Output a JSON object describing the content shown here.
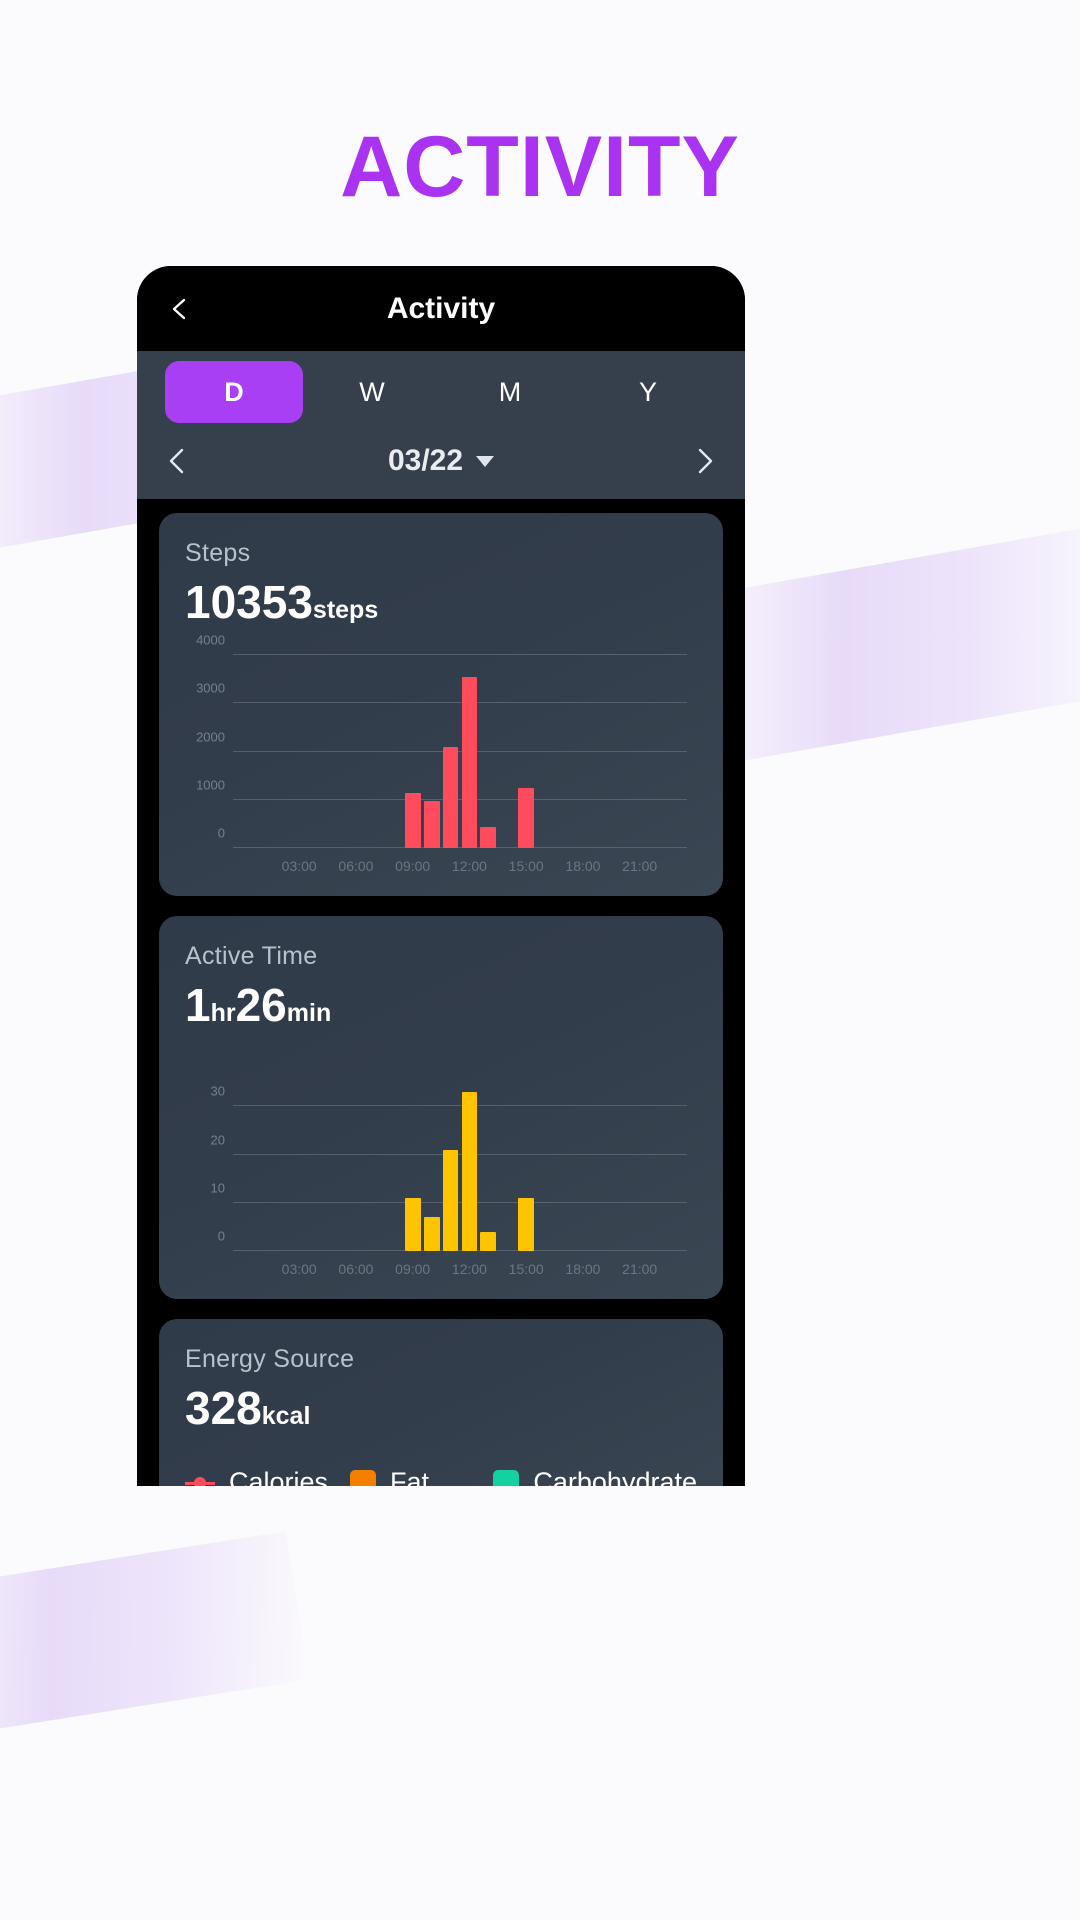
{
  "page": {
    "title": "ACTIVITY",
    "accent_purple": "#a933f0",
    "background": "#fbfafd"
  },
  "phone": {
    "navbar": {
      "title": "Activity",
      "back_icon": "chevron-left-icon"
    },
    "segments": [
      {
        "label": "D",
        "active": true
      },
      {
        "label": "W",
        "active": false
      },
      {
        "label": "M",
        "active": false
      },
      {
        "label": "Y",
        "active": false
      }
    ],
    "date_nav": {
      "prev_icon": "chevron-left-icon",
      "next_icon": "chevron-right-icon",
      "date": "03/22",
      "dropdown_icon": "caret-down-icon"
    },
    "cards": [
      {
        "label": "Steps",
        "value": "10353",
        "unit": "steps"
      },
      {
        "label": "Active Time",
        "value_parts": [
          {
            "num": "1",
            "unit": "hr"
          },
          {
            "num": "26",
            "unit": "min"
          }
        ]
      },
      {
        "label": "Energy Source",
        "value": "328",
        "unit": "kcal",
        "legend": [
          {
            "name": "Calories",
            "color": "#ff4b5c",
            "marker": "line-dot"
          },
          {
            "name": "Fat",
            "color": "#f58000",
            "marker": "square"
          },
          {
            "name": "Carbohydrate",
            "color": "#13d1a0",
            "marker": "square"
          }
        ]
      }
    ]
  },
  "chart_data": [
    {
      "id": "steps",
      "type": "bar",
      "title": "Steps",
      "color": "#ff4b5c",
      "xlabel": "",
      "ylabel": "steps",
      "ylim": [
        0,
        4000
      ],
      "yticks": [
        0,
        1000,
        2000,
        3000,
        4000
      ],
      "ytick_labels": [
        "0",
        "1000",
        "2000",
        "3000",
        "4000"
      ],
      "xticks": [
        "03:00",
        "06:00",
        "09:00",
        "12:00",
        "15:00",
        "18:00",
        "21:00"
      ],
      "categories": [
        "09:00",
        "10:00",
        "11:00",
        "12:00",
        "13:00",
        "15:00"
      ],
      "values": [
        1150,
        980,
        2100,
        3550,
        430,
        1250
      ],
      "grid": true,
      "total": 10353
    },
    {
      "id": "active_time",
      "type": "bar",
      "title": "Active Time",
      "color": "#ffc400",
      "xlabel": "",
      "ylabel": "min",
      "ylim": [
        0,
        40
      ],
      "yticks": [
        0,
        10,
        20,
        30
      ],
      "ytick_labels": [
        "0",
        "10",
        "20",
        "30"
      ],
      "xticks": [
        "03:00",
        "06:00",
        "09:00",
        "12:00",
        "15:00",
        "18:00",
        "21:00"
      ],
      "categories": [
        "09:00",
        "10:00",
        "11:00",
        "12:00",
        "13:00",
        "15:00"
      ],
      "values": [
        11,
        7,
        21,
        33,
        4,
        11
      ],
      "grid": true,
      "total_hr": 1,
      "total_min": 26
    },
    {
      "id": "energy_source",
      "type": "bar",
      "title": "Energy Source",
      "total_kcal": 328,
      "series": [
        {
          "name": "Calories",
          "color": "#ff4b5c"
        },
        {
          "name": "Fat",
          "color": "#f58000"
        },
        {
          "name": "Carbohydrate",
          "color": "#13d1a0"
        }
      ]
    }
  ]
}
